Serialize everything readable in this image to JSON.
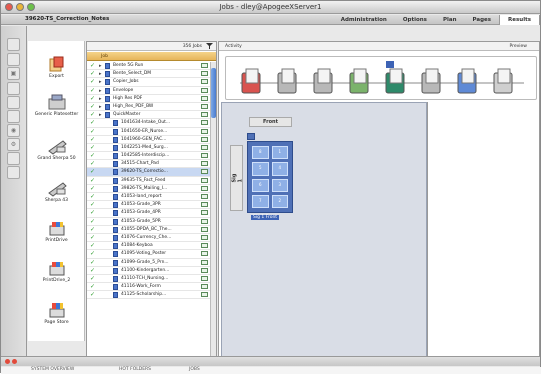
{
  "window": {
    "title": "Jobs - dley@ApogeeXServer1"
  },
  "toolbar": {
    "project_title": "39620-TS_Correction_Notes"
  },
  "tabs": [
    {
      "label": "Administration"
    },
    {
      "label": "Options"
    },
    {
      "label": "Plan"
    },
    {
      "label": "Pages"
    },
    {
      "label": "Results",
      "active": true
    }
  ],
  "devices": [
    {
      "label": "Export",
      "icon": "export-icon"
    },
    {
      "label": "Generic Platesetter",
      "icon": "platesetter-icon"
    },
    {
      "label": "Grand Sherpa 50",
      "icon": "proofer-icon"
    },
    {
      "label": "Sherpa 43",
      "icon": "proofer-icon"
    },
    {
      "label": "PrintDrive",
      "icon": "printdrive-icon"
    },
    {
      "label": "PrintDrive_2",
      "icon": "printdrive-icon"
    },
    {
      "label": "Page Store",
      "icon": "pagestore-icon"
    }
  ],
  "joblist": {
    "count_label": "356 Jobs",
    "column_header": "Job",
    "rows": [
      {
        "name": "Bente 5G Run",
        "type": "folder",
        "indent": 0
      },
      {
        "name": "Bente_Select_DM",
        "type": "folder",
        "indent": 0
      },
      {
        "name": "Copier_Jobs",
        "type": "folder",
        "indent": 0
      },
      {
        "name": "Envelope",
        "type": "folder",
        "indent": 0
      },
      {
        "name": "High Res PDF",
        "type": "folder",
        "indent": 0
      },
      {
        "name": "High_Res_PDF_BW",
        "type": "folder",
        "indent": 0
      },
      {
        "name": "QuickMaster",
        "type": "folder",
        "indent": 0
      },
      {
        "name": "1041634-Intake_Out...",
        "type": "job",
        "indent": 1
      },
      {
        "name": "1041650-ER_Nurse...",
        "type": "job",
        "indent": 1
      },
      {
        "name": "1041960-GEN_FAC...",
        "type": "job",
        "indent": 1
      },
      {
        "name": "1042251-Med_Surg...",
        "type": "job",
        "indent": 1
      },
      {
        "name": "1042585-Interdiscip...",
        "type": "job",
        "indent": 1
      },
      {
        "name": "34515-Chart_Pad",
        "type": "job",
        "indent": 1
      },
      {
        "name": "39620-TS_Correctio...",
        "type": "job",
        "indent": 1,
        "selected": true
      },
      {
        "name": "39635-TS_Fact_Feed",
        "type": "job",
        "indent": 1
      },
      {
        "name": "39826-TS_Mailing_I...",
        "type": "job",
        "indent": 1
      },
      {
        "name": "41053-land_report",
        "type": "job",
        "indent": 1
      },
      {
        "name": "41053-Grade_3PR",
        "type": "job",
        "indent": 1
      },
      {
        "name": "41053-Grade_4PR",
        "type": "job",
        "indent": 1
      },
      {
        "name": "41053-Grade_5PR",
        "type": "job",
        "indent": 1
      },
      {
        "name": "41055-DPDA_BC_The...",
        "type": "job",
        "indent": 1
      },
      {
        "name": "41076-Currency_Che...",
        "type": "job",
        "indent": 1
      },
      {
        "name": "41084-Keyboa",
        "type": "job",
        "indent": 1
      },
      {
        "name": "41095-Voting_Poster",
        "type": "job",
        "indent": 1
      },
      {
        "name": "41099-Grade_5_Prn...",
        "type": "job",
        "indent": 1
      },
      {
        "name": "41100-Kindergarten...",
        "type": "job",
        "indent": 1
      },
      {
        "name": "41110-TCH_Nursing...",
        "type": "job",
        "indent": 1
      },
      {
        "name": "41116-Work_Form",
        "type": "job",
        "indent": 1
      },
      {
        "name": "41125-Scholarship...",
        "type": "job",
        "indent": 1
      }
    ]
  },
  "activity": {
    "label": "Activity",
    "preview_label": "Preview"
  },
  "workflow": {
    "steps": [
      "pdf-input-icon",
      "normalize-icon",
      "preflight-icon",
      "imposition-icon",
      "render-icon",
      "separation-icon",
      "output-icon",
      "printer-icon"
    ]
  },
  "layout": {
    "front_label": "Front",
    "signature_label": "Sig 1",
    "sheet_label": "Sig 1 Front",
    "pages": [
      "8",
      "1",
      "5",
      "4",
      "6",
      "3",
      "7",
      "2"
    ]
  },
  "bottom": {
    "tabs": [
      "SYSTEM OVERVIEW",
      "HOT FOLDERS",
      "JOBS"
    ]
  },
  "colors": {
    "accent": "#4f70b6",
    "column_header": "#e6b55a",
    "selected_row": "#c8d8f2"
  }
}
